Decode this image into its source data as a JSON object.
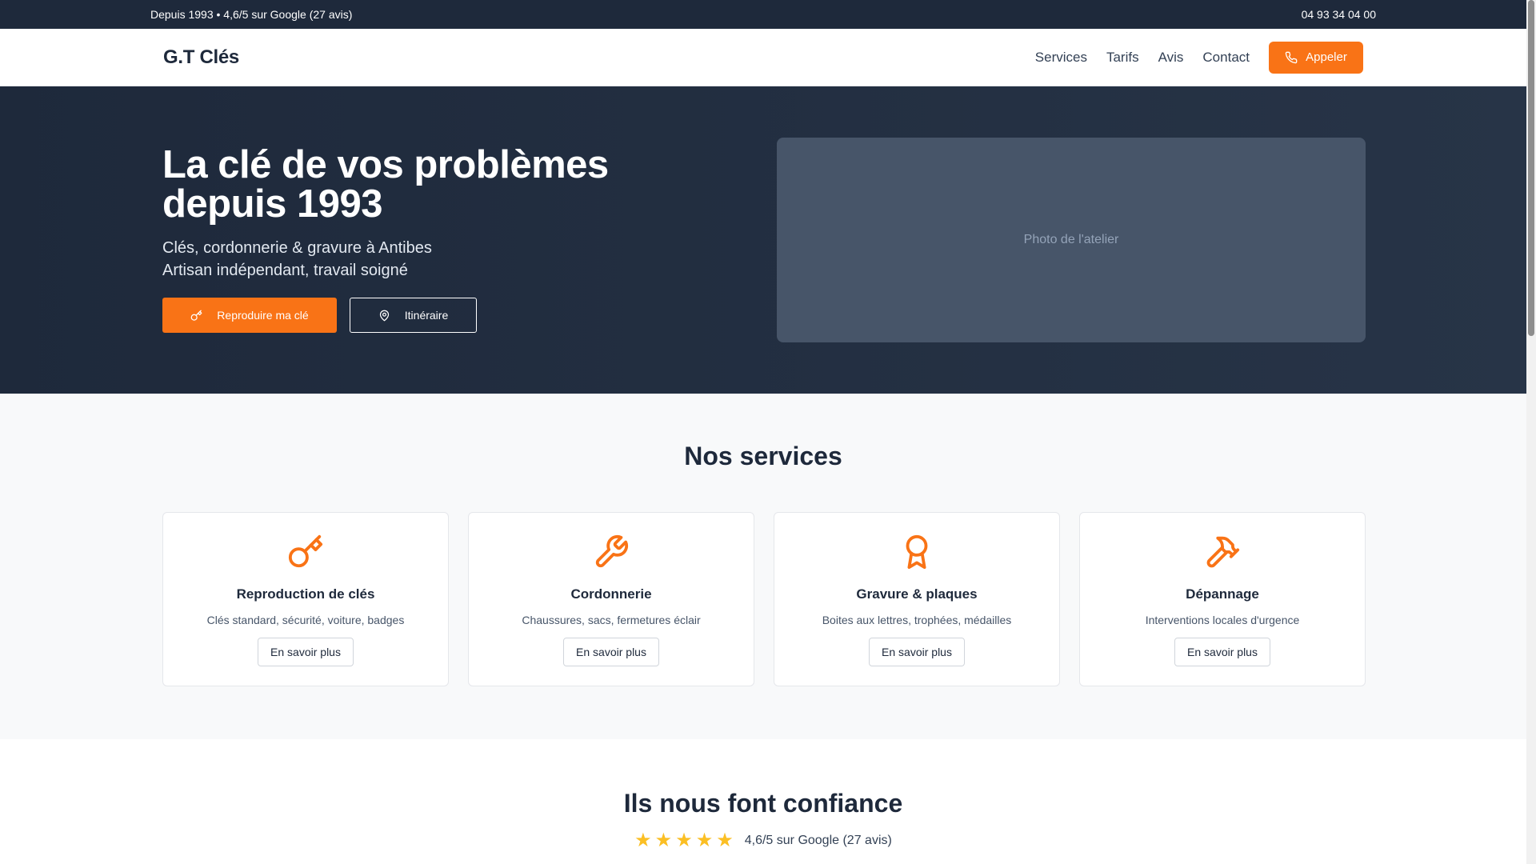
{
  "topbar": {
    "tagline": "Depuis 1993 • 4,6/5 sur Google (27 avis)",
    "phone": "04 93 34 04 00"
  },
  "header": {
    "logo": "G.T Clés",
    "nav": [
      "Services",
      "Tarifs",
      "Avis",
      "Contact"
    ],
    "call_label": "Appeler"
  },
  "hero": {
    "title_line1": "La clé de vos problèmes",
    "title_line2": "depuis 1993",
    "subtitle_line1": "Clés, cordonnerie & gravure à Antibes",
    "subtitle_line2": "Artisan indépendant, travail soigné",
    "primary_label": "Reproduire ma clé",
    "secondary_label": "Itinéraire",
    "photo_placeholder": "Photo de l'atelier"
  },
  "services": {
    "heading": "Nos services",
    "items": [
      {
        "title": "Reproduction de clés",
        "desc": "Clés standard, sécurité, voiture, badges",
        "button": "En savoir plus",
        "icon": "key-icon"
      },
      {
        "title": "Cordonnerie",
        "desc": "Chaussures, sacs, fermetures éclair",
        "button": "En savoir plus",
        "icon": "wrench-icon"
      },
      {
        "title": "Gravure & plaques",
        "desc": "Boites aux lettres, trophées, médailles",
        "button": "En savoir plus",
        "icon": "award-icon"
      },
      {
        "title": "Dépannage",
        "desc": "Interventions locales d'urgence",
        "button": "En savoir plus",
        "icon": "hammer-icon"
      }
    ]
  },
  "reviews": {
    "heading": "Ils nous font confiance",
    "stars": 5,
    "rating_text": "4,6/5 sur Google (27 avis)"
  },
  "colors": {
    "accent": "#f97316",
    "dark": "#1e293b",
    "star": "#fbbf24"
  }
}
